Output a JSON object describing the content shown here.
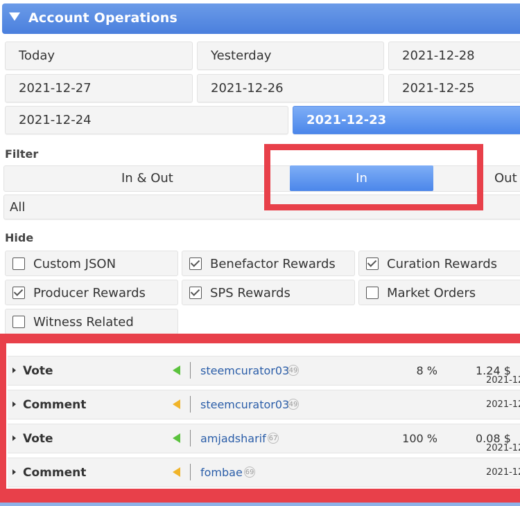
{
  "panel": {
    "title": "Account Operations"
  },
  "dates": [
    "Today",
    "Yesterday",
    "2021-12-28",
    "2021-12-27",
    "2021-12-26",
    "2021-12-25",
    "2021-12-24",
    "2021-12-23"
  ],
  "filter": {
    "label": "Filter",
    "options": [
      "In & Out",
      "In",
      "Out"
    ],
    "selected": "In",
    "scope": "All"
  },
  "hide": {
    "label": "Hide",
    "items": [
      {
        "label": "Custom JSON",
        "checked": false
      },
      {
        "label": "Benefactor Rewards",
        "checked": true
      },
      {
        "label": "Curation Rewards",
        "checked": true
      },
      {
        "label": "Producer Rewards",
        "checked": true
      },
      {
        "label": "SPS Rewards",
        "checked": true
      },
      {
        "label": "Market Orders",
        "checked": false
      },
      {
        "label": "Witness Related",
        "checked": false
      }
    ]
  },
  "operations": [
    {
      "type": "Vote",
      "direction_color": "green",
      "account": "steemcurator03",
      "reputation": "49",
      "percent": "8 %",
      "amount": "1.24 $",
      "date": "2021-12"
    },
    {
      "type": "Comment",
      "direction_color": "yellow",
      "account": "steemcurator03",
      "reputation": "49",
      "percent": "",
      "amount": "",
      "date": "2021-12"
    },
    {
      "type": "Vote",
      "direction_color": "green",
      "account": "amjadsharif",
      "reputation": "67",
      "percent": "100 %",
      "amount": "0.08 $",
      "date": "2021-12"
    },
    {
      "type": "Comment",
      "direction_color": "yellow",
      "account": "fombae",
      "reputation": "69",
      "percent": "",
      "amount": "",
      "date": "2021-12"
    }
  ],
  "colors": {
    "header": "#4a7fdd",
    "selected": "#4b86ea",
    "highlight": "#e8404a",
    "link": "#2a5da8"
  }
}
